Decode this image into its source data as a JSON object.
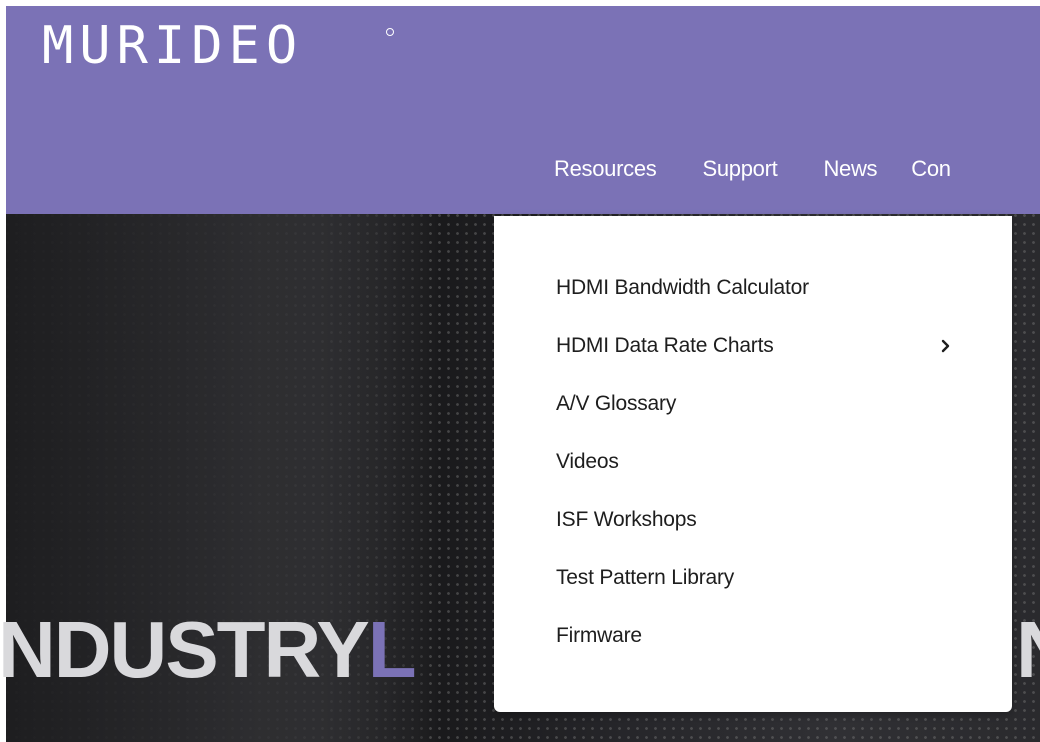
{
  "header": {
    "logo_text": "MURIDEO",
    "background_color": "#7b72b6",
    "nav": [
      {
        "label": "Resources"
      },
      {
        "label": "Support"
      },
      {
        "label": "News"
      },
      {
        "label": "Con"
      }
    ]
  },
  "dropdown": {
    "items": [
      {
        "label": "HDMI Bandwidth Calculator"
      },
      {
        "label": "HDMI Data Rate Charts",
        "icon": "chevron-right-icon"
      },
      {
        "label": "A/V Glossary"
      },
      {
        "label": "Videos"
      },
      {
        "label": "ISF Workshops"
      },
      {
        "label": "Test Pattern Library"
      },
      {
        "label": "Firmware"
      }
    ]
  },
  "hero": {
    "headline_visible": "NDUSTRY",
    "headline_accent": "L",
    "headline_right": "N",
    "accent_color": "#7b72b6"
  }
}
